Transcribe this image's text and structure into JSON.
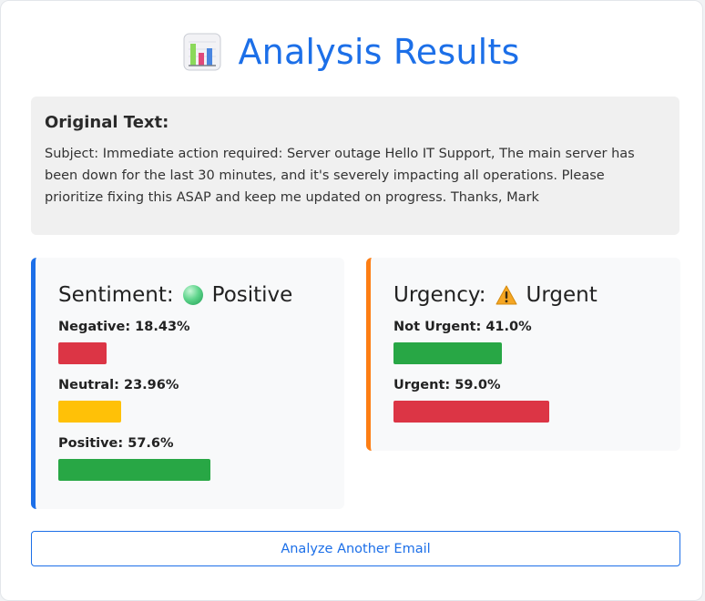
{
  "header": {
    "title": "Analysis Results",
    "icon": "bar-chart-icon"
  },
  "original": {
    "heading": "Original Text:",
    "body": "Subject: Immediate action required: Server outage Hello IT Support, The main server has been down for the last 30 minutes, and it's severely impacting all operations. Please prioritize fixing this ASAP and keep me updated on progress. Thanks, Mark"
  },
  "sentiment": {
    "heading": "Sentiment:",
    "icon": "green-circle-icon",
    "result": "Positive",
    "rows": [
      {
        "label": "Negative: 18.43%",
        "value": 18.43,
        "color": "#dc3545"
      },
      {
        "label": "Neutral: 23.96%",
        "value": 23.96,
        "color": "#ffc107"
      },
      {
        "label": "Positive: 57.6%",
        "value": 57.6,
        "color": "#28a745"
      }
    ]
  },
  "urgency": {
    "heading": "Urgency:",
    "icon": "warning-icon",
    "result": "Urgent",
    "rows": [
      {
        "label": "Not Urgent: 41.0%",
        "value": 41.0,
        "color": "#28a745"
      },
      {
        "label": "Urgent: 59.0%",
        "value": 59.0,
        "color": "#dc3545"
      }
    ]
  },
  "actions": {
    "analyze_again": "Analyze Another Email"
  },
  "colors": {
    "accent": "#1c6fe8",
    "urgency_accent": "#fd7e14"
  }
}
